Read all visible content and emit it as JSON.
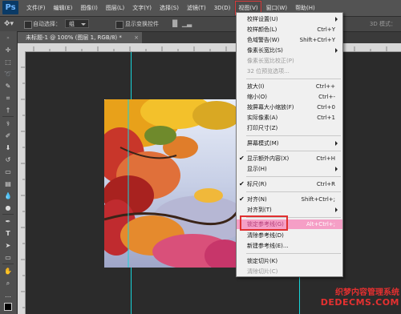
{
  "app": {
    "logo": "Ps"
  },
  "menubar": {
    "items": [
      "文件(F)",
      "编辑(E)",
      "图像(I)",
      "图层(L)",
      "文字(Y)",
      "选择(S)",
      "滤镜(T)",
      "3D(D)",
      "视图(V)",
      "窗口(W)",
      "帮助(H)"
    ],
    "active": "视图(V)"
  },
  "options": {
    "auto_select_label": "自动选择：",
    "auto_select_value": "组",
    "show_transform_label": "显示变换控件",
    "mode_3d": "3D 模式："
  },
  "document": {
    "tab_title": "未标题-1 @ 100% (图层 1, RGB/8) *",
    "close": "×"
  },
  "view_menu": {
    "items": [
      {
        "label": "校样设置(U)",
        "shortcut": "",
        "submenu": true,
        "disabled": false
      },
      {
        "label": "校样颜色(L)",
        "shortcut": "Ctrl+Y",
        "submenu": false,
        "disabled": false
      },
      {
        "label": "色域警告(W)",
        "shortcut": "Shift+Ctrl+Y",
        "submenu": false,
        "disabled": false
      },
      {
        "label": "像素长宽比(S)",
        "shortcut": "",
        "submenu": true,
        "disabled": false
      },
      {
        "label": "像素长宽比校正(P)",
        "shortcut": "",
        "submenu": false,
        "disabled": true
      },
      {
        "label": "32 位预览选项...",
        "shortcut": "",
        "submenu": false,
        "disabled": true
      },
      {
        "label": "放大(I)",
        "shortcut": "Ctrl++",
        "submenu": false,
        "disabled": false
      },
      {
        "label": "缩小(O)",
        "shortcut": "Ctrl+-",
        "submenu": false,
        "disabled": false
      },
      {
        "label": "按屏幕大小缩放(F)",
        "shortcut": "Ctrl+0",
        "submenu": false,
        "disabled": false
      },
      {
        "label": "实际像素(A)",
        "shortcut": "Ctrl+1",
        "submenu": false,
        "disabled": false
      },
      {
        "label": "打印尺寸(Z)",
        "shortcut": "",
        "submenu": false,
        "disabled": false
      },
      {
        "label": "屏幕模式(M)",
        "shortcut": "",
        "submenu": true,
        "disabled": false
      },
      {
        "label": "显示额外内容(X)",
        "shortcut": "Ctrl+H",
        "submenu": false,
        "disabled": false,
        "checked": true
      },
      {
        "label": "显示(H)",
        "shortcut": "",
        "submenu": true,
        "disabled": false
      },
      {
        "label": "标尺(R)",
        "shortcut": "Ctrl+R",
        "submenu": false,
        "disabled": false,
        "checked": true
      },
      {
        "label": "对齐(N)",
        "shortcut": "Shift+Ctrl+;",
        "submenu": false,
        "disabled": false,
        "checked": true
      },
      {
        "label": "对齐到(T)",
        "shortcut": "",
        "submenu": true,
        "disabled": false
      },
      {
        "label": "锁定参考线(G)",
        "shortcut": "Alt+Ctrl+;",
        "submenu": false,
        "disabled": false,
        "highlighted": true
      },
      {
        "label": "清除参考线(D)",
        "shortcut": "",
        "submenu": false,
        "disabled": false
      },
      {
        "label": "新建参考线(E)...",
        "shortcut": "",
        "submenu": false,
        "disabled": false
      },
      {
        "label": "锁定切片(K)",
        "shortcut": "",
        "submenu": false,
        "disabled": false
      },
      {
        "label": "清除切片(C)",
        "shortcut": "",
        "submenu": false,
        "disabled": true
      }
    ]
  },
  "watermark": {
    "line1": "织梦内容管理系统",
    "line2": "DEDECMS.COM"
  },
  "colors": {
    "highlight": "#f59fc6",
    "guide": "#18d4d9",
    "annotation": "#e03030"
  }
}
